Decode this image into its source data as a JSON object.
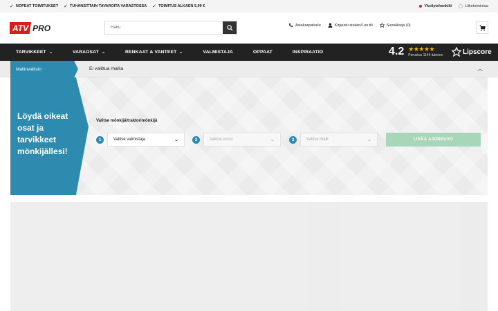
{
  "usp": [
    "NOPEAT TOIMITUKSET",
    "TUHANSITTAIN TAVAROITA VARASTOSSA",
    "TOIMITUS ALKAEN 5,99 €"
  ],
  "customer_type": {
    "private": "Yksityishenkilö",
    "business": "Liiketoimintaa",
    "selected": "private"
  },
  "logo": {
    "part1": "ATV",
    "part2": "PRO"
  },
  "search": {
    "placeholder": "Haku"
  },
  "header_links": {
    "customer_service": "Asiakaspalvelu",
    "login": "Kirjaudu sisään/Luo tili",
    "favorites": "Suosikkeja (0)"
  },
  "nav": [
    {
      "label": "TARVIKKEET",
      "dropdown": true
    },
    {
      "label": "VARAOSAT",
      "dropdown": true
    },
    {
      "label": "RENKAAT & VANTEET",
      "dropdown": true
    },
    {
      "label": "VALMISTAJA",
      "dropdown": false
    },
    {
      "label": "OPPAAT",
      "dropdown": false
    },
    {
      "label": "INSPIRAATIO",
      "dropdown": false
    }
  ],
  "rating": {
    "score": "4.2",
    "stars": "★★★★★",
    "filled": 4.2,
    "basis": "Perustuu 1144 ääneen",
    "brand": "Lipscore"
  },
  "model_bar": {
    "tab": "Mallinvalitsin",
    "status": "Ei valittua mallia"
  },
  "selector": {
    "headline": "Löydä oikeat osat ja tarvikkeet mönkijällesi!",
    "title": "Valitse mönkijä/traktorimönkijä",
    "steps": [
      {
        "num": "1",
        "label": "Valitse valmistaja",
        "enabled": true
      },
      {
        "num": "2",
        "label": "Valitse vuosi",
        "enabled": false
      },
      {
        "num": "3",
        "label": "Valitse malli",
        "enabled": false
      }
    ],
    "add_button": "LISÄÄ AJONEUVO"
  },
  "colors": {
    "brand_red": "#d4201a",
    "accent_blue": "#2d8bb0",
    "nav_bg": "#222222",
    "star": "#f5b400",
    "add_button": "#a7d6b9"
  }
}
